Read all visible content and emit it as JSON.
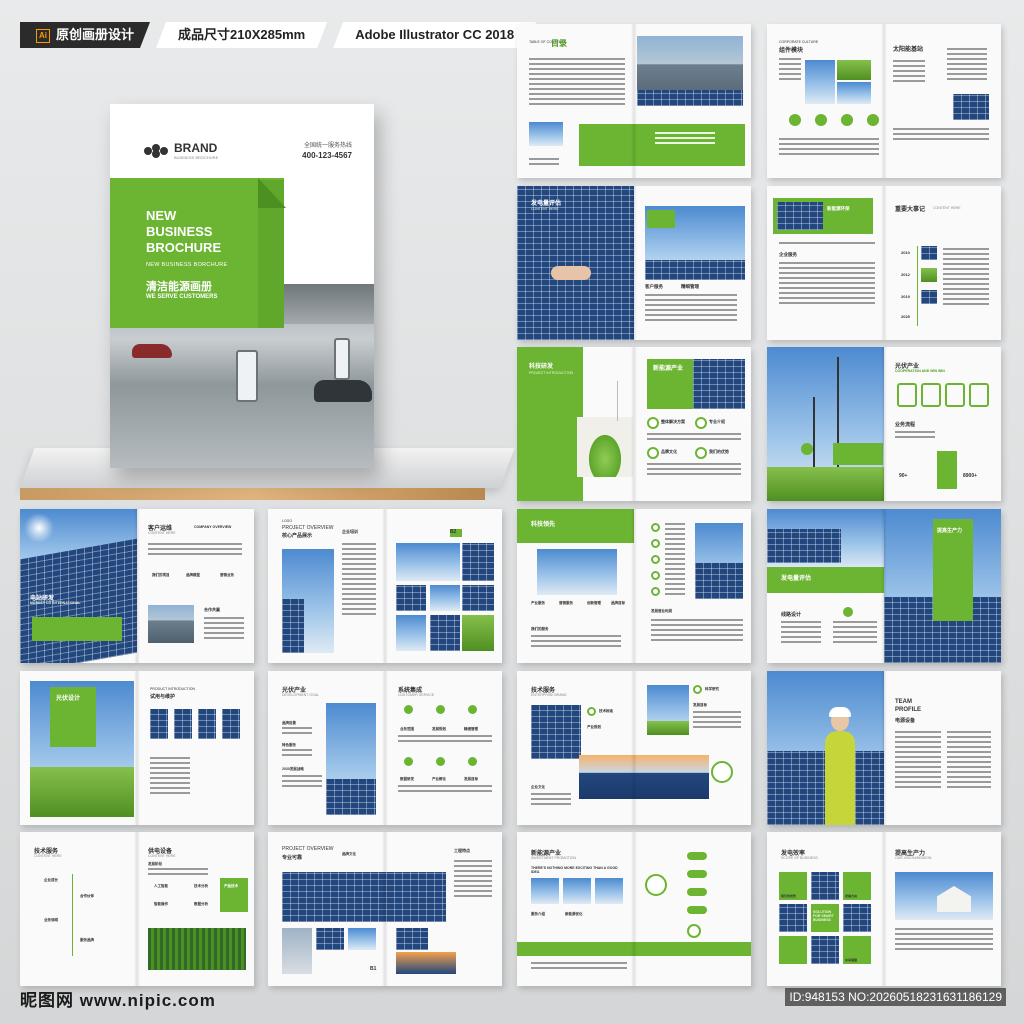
{
  "header": {
    "tags": [
      {
        "ai": "Ai",
        "label": "原创画册设计"
      },
      {
        "label": "成品尺寸210X285mm"
      },
      {
        "label": "Adobe Illustrator CC 2018"
      }
    ]
  },
  "cover": {
    "brand": "BRAND",
    "brand_sub": "BUSINESS BROCHURE",
    "hotline_label": "全国统一服务热线",
    "hotline_number": "400-123-4567",
    "title_1": "NEW",
    "title_2": "BUSINESS",
    "title_3": "BROCHURE",
    "subtitle": "NEW BUSINESS BORCHURE",
    "title_cn": "清洁能源画册",
    "tagline": "WE SERVE CUSTOMERS"
  },
  "spreads": {
    "toc": {
      "en": "TABLE OF CONTENTS",
      "cn": "目录"
    },
    "culture": {
      "en": "CORPORATE CULTURE",
      "cn": "组件模块",
      "right": "太阳能基站"
    },
    "evaluate": {
      "cn": "发电量评估",
      "en": "CONTENT HERE",
      "left_a": "客户服务",
      "left_b": "精细管理"
    },
    "eco": {
      "cn": "新能源环保",
      "events": "重要大事记",
      "events_en": "CONTENT HERE",
      "years": [
        "2010",
        "2012",
        "2019",
        "2025"
      ],
      "service": "企业服务"
    },
    "tech": {
      "cn": "科技研发",
      "en": "PROJECT INTRODUCTION",
      "right": "新能源产业",
      "labels": [
        "整体解决方案",
        "专业介绍",
        "品牌文化",
        "我们的优势"
      ]
    },
    "pv_industry": {
      "cn": "光伏产业",
      "en": "COOPERATION AND WIN WIN",
      "biz": "业务流程",
      "stats": [
        "90+",
        "8900+"
      ]
    },
    "customer": {
      "cn": "客户运维",
      "en": "CONTENT HERE",
      "company": "COMPANY OVERVIEW",
      "left": "电站研发",
      "left_en": "MARKET CO INTERNATIONAL",
      "items": [
        "我们的项目",
        "品牌模型",
        "营销业务",
        "合作共赢"
      ]
    },
    "overview": {
      "logo": "LOGO",
      "en": "PROJECT OVERVIEW",
      "cn": "核心产品展示",
      "right": "企业培训",
      "tag": "B2"
    },
    "tech_adv": {
      "cn": "科技领先",
      "labels": [
        "产业服务",
        "营销服务",
        "创新管理",
        "品牌目标",
        "我们的服务",
        "发展营业利润"
      ]
    },
    "capacity": {
      "cn": "提高生产力",
      "left": "发电量评估",
      "line": "线路设计"
    },
    "pv_design": {
      "cn": "光伏设计",
      "right_en": "PRODUCT INTRODUCTION",
      "right": "试用与维护"
    },
    "pv_dev": {
      "cn": "光伏产业",
      "en": "DEVELOPMENT GOAL",
      "labels": [
        "品牌前景",
        "特色服务",
        "2030发展战略"
      ],
      "system": "系统集成",
      "system_en": "CUSTOMER SERVICE",
      "items": [
        "业务范围",
        "发展规划",
        "精细管理",
        "数据研发",
        "产业孵化",
        "发展目标"
      ]
    },
    "tech_service": {
      "cn": "技术服务",
      "en": "ENTERPRISE BRAND",
      "items": [
        "技术标准",
        "产业规划",
        "企业文化",
        "科学研究",
        "发展目标"
      ]
    },
    "team": {
      "en1": "TEAM",
      "en2": "PROFILE",
      "cn": "电源设备"
    },
    "tech_service2": {
      "cn": "技术服务",
      "en": "CONTENT HERE",
      "items": [
        "企业成长",
        "合作伙伴",
        "业务领域",
        "服务品牌"
      ],
      "supply": "供电设备",
      "supply_en": "CONTENT HERE",
      "supply_items": [
        "发展阶段",
        "人工智能",
        "技术分析",
        "智能操作",
        "数据分析"
      ],
      "badge": "产品技术"
    },
    "overview2": {
      "en": "PROJECT OVERVIEW",
      "cn": "专业可靠",
      "brand": "品牌文化",
      "right": "工程特点",
      "tag": "B1"
    },
    "new_energy": {
      "cn": "新能源产业",
      "en": "INVESTMENT PROMOTION",
      "slogan": "THERE'S NOTHING MORE EXCITING THAN A GOOD IDEA",
      "labels": [
        "服务介绍",
        "新能源优化"
      ]
    },
    "power": {
      "cn": "发电效率",
      "en": "SCOPE OF BUSINESS",
      "right": "提高生产力",
      "right_en": "OUR VISION/MISSION",
      "mid": "SOLUTION FOR SMART BUSINESS",
      "labels": [
        "我们的优势",
        "发展方向",
        "未来展望"
      ]
    }
  },
  "footer": {
    "watermark": "昵图网 www.nipic.com",
    "id": "ID:948153 NO:20260518231631186129"
  }
}
